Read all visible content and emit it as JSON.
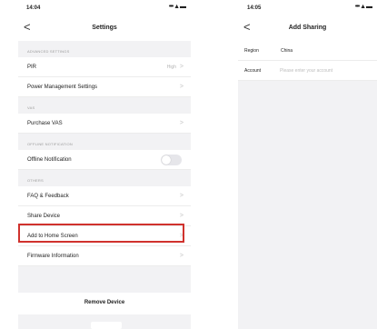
{
  "left_screen": {
    "status_time": "14:04",
    "status_icons": "••• ▲ ▬",
    "title": "Settings",
    "back_glyph": "<",
    "sections": [
      {
        "header": "ADVANCED SETTINGS",
        "rows": [
          {
            "label": "PIR",
            "value": "High"
          },
          {
            "label": "Power Management Settings",
            "value": ""
          }
        ]
      },
      {
        "header": "VAS",
        "rows": [
          {
            "label": "Purchase VAS",
            "value": ""
          }
        ]
      },
      {
        "header": "OFFLINE NOTIFICATION",
        "rows": [
          {
            "label": "Offline Notification",
            "toggle": false
          }
        ]
      },
      {
        "header": "OTHERS",
        "rows": [
          {
            "label": "FAQ & Feedback"
          },
          {
            "label": "Share Device"
          },
          {
            "label": "Add to Home Screen"
          },
          {
            "label": "Firmware Information"
          }
        ]
      }
    ],
    "remove_label": "Remove Device",
    "chevron": ">"
  },
  "right_screen": {
    "status_time": "14:05",
    "title": "Add Sharing",
    "back_glyph": "<",
    "region_label": "Region",
    "region_value": "China",
    "account_label": "Account",
    "account_placeholder": "Please enter your account"
  },
  "colors": {
    "highlight": "#d0322d",
    "background": "#f2f2f4"
  }
}
